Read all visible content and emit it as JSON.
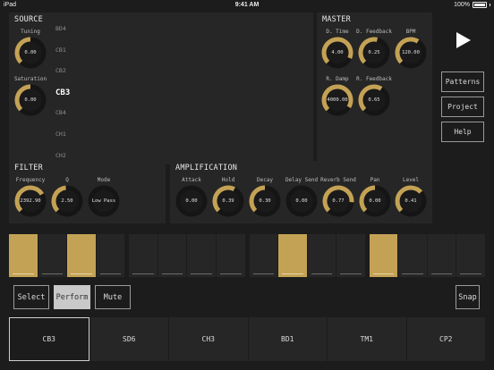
{
  "status": {
    "left": "iPad",
    "time": "9:41 AM",
    "battery": "100%"
  },
  "accent": "#c4a255",
  "source": {
    "title": "SOURCE",
    "knobs": [
      {
        "label": "Tuning",
        "value": "0.00",
        "level": 0.5
      },
      {
        "label": "Saturation",
        "value": "0.00",
        "level": 0.5
      }
    ],
    "channels": [
      {
        "label": "BD4",
        "active": false
      },
      {
        "label": "CB1",
        "active": false
      },
      {
        "label": "CB2",
        "active": false
      },
      {
        "label": "CB3",
        "active": true
      },
      {
        "label": "CB4",
        "active": false
      },
      {
        "label": "CH1",
        "active": false
      },
      {
        "label": "CH2",
        "active": false
      }
    ]
  },
  "master": {
    "title": "MASTER",
    "knobs": [
      {
        "label": "D. Time",
        "value": "4.00",
        "level": 0.92
      },
      {
        "label": "D. Feedback",
        "value": "0.25",
        "level": 0.55
      },
      {
        "label": "BPM",
        "value": "120.00",
        "level": 0.62
      },
      {
        "label": "R. Damp",
        "value": "4000.00",
        "level": 0.95
      },
      {
        "label": "R. Feedback",
        "value": "0.65",
        "level": 0.62
      }
    ]
  },
  "filter": {
    "title": "FILTER",
    "knobs": [
      {
        "label": "Frequency",
        "value": "2392.90",
        "level": 0.72
      },
      {
        "label": "Q",
        "value": "2.50",
        "level": 0.48
      },
      {
        "label": "Mode",
        "value": "Low Pass",
        "level": 0.0
      }
    ]
  },
  "amplification": {
    "title": "AMPLIFICATION",
    "knobs": [
      {
        "label": "Attack",
        "value": "0.00",
        "level": 0.0
      },
      {
        "label": "Hold",
        "value": "0.39",
        "level": 0.6
      },
      {
        "label": "Decay",
        "value": "0.30",
        "level": 0.5
      },
      {
        "label": "Delay Send",
        "value": "0.00",
        "level": 0.0
      },
      {
        "label": "Reverb Send",
        "value": "0.77",
        "level": 0.85
      },
      {
        "label": "Pan",
        "value": "0.00",
        "level": 0.5
      },
      {
        "label": "Level",
        "value": "0.41",
        "level": 0.68
      }
    ]
  },
  "side": {
    "patterns": "Patterns",
    "project": "Project",
    "help": "Help"
  },
  "steps": [
    1,
    0,
    0,
    1,
    0,
    0,
    0,
    0,
    0,
    1,
    0,
    0,
    0,
    0,
    0,
    1,
    0,
    0,
    0,
    0,
    0,
    0,
    0,
    0,
    0,
    0,
    0,
    0,
    1,
    0,
    0,
    0,
    0,
    0,
    0,
    0,
    0,
    0,
    0,
    0,
    1,
    0,
    0,
    0,
    0,
    0,
    0,
    0,
    0,
    0,
    0,
    0,
    0,
    0,
    0,
    0,
    0,
    0,
    0,
    0,
    0,
    0,
    0,
    0
  ],
  "modes": {
    "select": "Select",
    "perform": "Perform",
    "mute": "Mute",
    "snap": "Snap"
  },
  "tracks": [
    {
      "label": "CB3",
      "active": true
    },
    {
      "label": "SD6",
      "active": false
    },
    {
      "label": "CH3",
      "active": false
    },
    {
      "label": "BD1",
      "active": false
    },
    {
      "label": "TM1",
      "active": false
    },
    {
      "label": "CP2",
      "active": false
    }
  ]
}
